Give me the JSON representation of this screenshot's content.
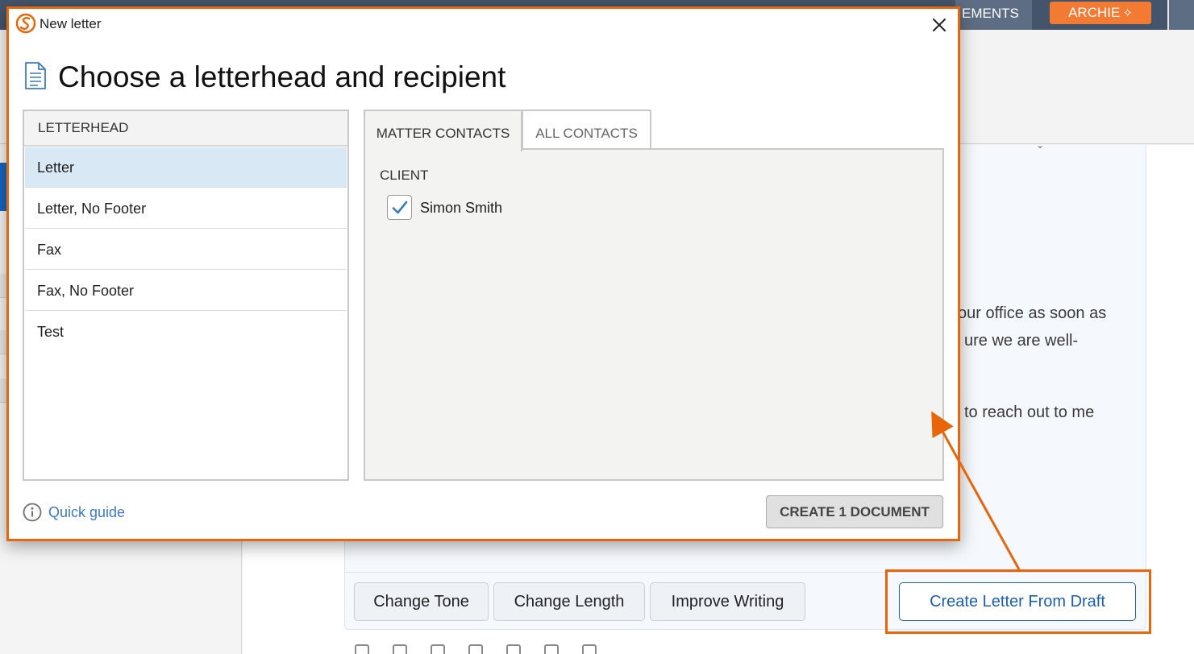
{
  "background": {
    "tabs": {
      "agreements": "EMENTS",
      "archie": "ARCHIE"
    },
    "letter_text_fragments": [
      "our office as soon as",
      "ure we are well-",
      "to reach out to me"
    ],
    "archie_actions": {
      "change_tone": "Change Tone",
      "change_length": "Change Length",
      "improve_writing": "Improve Writing",
      "create_letter": "Create Letter From Draft"
    }
  },
  "dialog": {
    "title": "New letter",
    "heading": "Choose a letterhead and recipient",
    "letterhead": {
      "header": "LETTERHEAD",
      "items": [
        "Letter",
        "Letter, No Footer",
        "Fax",
        "Fax, No Footer",
        "Test"
      ],
      "selected": "Letter"
    },
    "recipients": {
      "tabs": [
        "MATTER CONTACTS",
        "ALL CONTACTS"
      ],
      "active_tab": "MATTER CONTACTS",
      "group_label": "CLIENT",
      "contacts": [
        {
          "name": "Simon Smith",
          "checked": true
        }
      ]
    },
    "quick_guide": "Quick guide",
    "create_button": "CREATE 1 DOCUMENT"
  },
  "colors": {
    "accent_orange": "#e8650a",
    "archie_orange": "#f37a32",
    "link_blue": "#3a7bc8",
    "primary_blue": "#1a5fb4",
    "selected_row": "#d9e8f5",
    "topbar": "#44546a"
  },
  "icons": {
    "app_logo": "smokeball-logo-icon",
    "close": "close-icon",
    "document": "document-icon",
    "info": "info-icon",
    "check": "checkmark-icon",
    "sparkle": "sparkle-icon"
  }
}
